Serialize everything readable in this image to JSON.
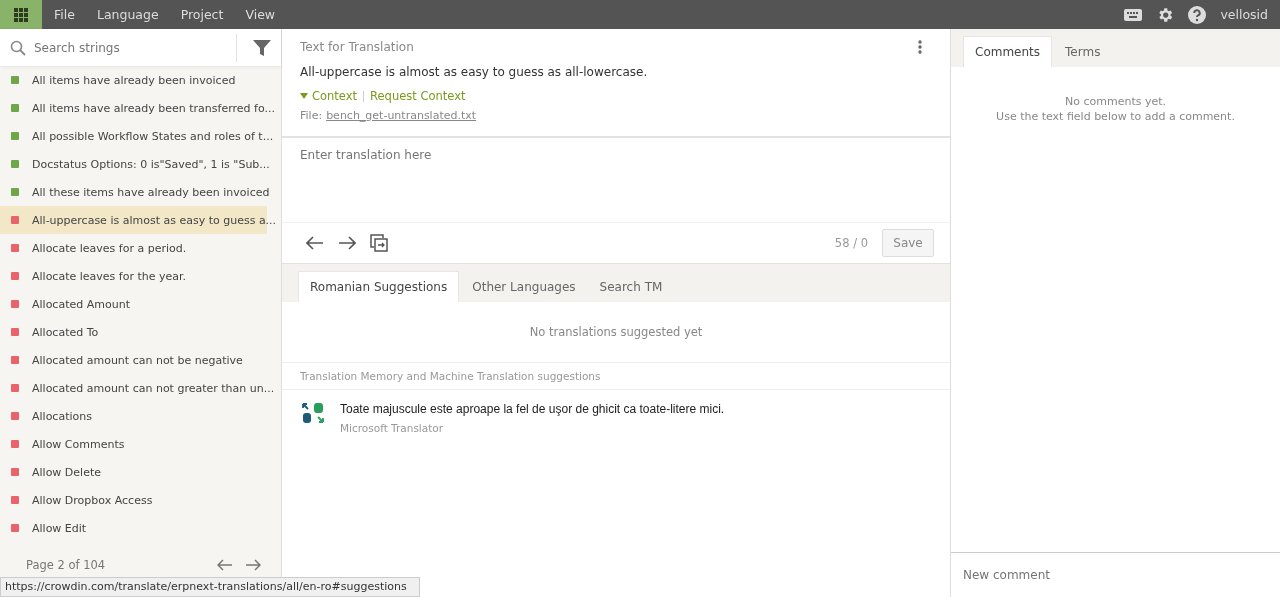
{
  "menu": [
    "File",
    "Language",
    "Project",
    "View"
  ],
  "user": "vellosid",
  "search": {
    "placeholder": "Search strings"
  },
  "strings": [
    {
      "text": "All items have already been invoiced",
      "translated": true,
      "selected": false
    },
    {
      "text": "All items have already been transferred fo...",
      "translated": true,
      "selected": false
    },
    {
      "text": "All possible Workflow States and roles of t...",
      "translated": true,
      "selected": false
    },
    {
      "text": "Docstatus Options: 0 is\"Saved\", 1 is \"Sub...",
      "translated": true,
      "selected": false
    },
    {
      "text": "All these items have already been invoiced",
      "translated": true,
      "selected": false
    },
    {
      "text": "All-uppercase is almost as easy to guess a...",
      "translated": false,
      "selected": true
    },
    {
      "text": "Allocate leaves for a period.",
      "translated": false,
      "selected": false
    },
    {
      "text": "Allocate leaves for the year.",
      "translated": false,
      "selected": false
    },
    {
      "text": "Allocated Amount",
      "translated": false,
      "selected": false
    },
    {
      "text": "Allocated To",
      "translated": false,
      "selected": false
    },
    {
      "text": "Allocated amount can not be negative",
      "translated": false,
      "selected": false
    },
    {
      "text": "Allocated amount can not greater than un...",
      "translated": false,
      "selected": false
    },
    {
      "text": "Allocations",
      "translated": false,
      "selected": false
    },
    {
      "text": "Allow Comments",
      "translated": false,
      "selected": false
    },
    {
      "text": "Allow Delete",
      "translated": false,
      "selected": false
    },
    {
      "text": "Allow Dropbox Access",
      "translated": false,
      "selected": false
    },
    {
      "text": "Allow Edit",
      "translated": false,
      "selected": false
    }
  ],
  "pager": "Page 2 of 104",
  "status_url": "https://crowdin.com/translate/erpnext-translations/all/en-ro#suggestions",
  "source": {
    "heading": "Text for Translation",
    "text": "All-uppercase is almost as easy to guess as all-lowercase.",
    "context": "Context",
    "request_context": "Request Context",
    "file_label": "File:",
    "file": "bench_get-untranslated.txt"
  },
  "translation": {
    "placeholder": "Enter translation here",
    "counter": "58 / 0",
    "save": "Save"
  },
  "suggestion_tabs": [
    {
      "label": "Romanian Suggestions",
      "selected": true
    },
    {
      "label": "Other Languages",
      "selected": false
    },
    {
      "label": "Search TM",
      "selected": false
    }
  ],
  "no_suggestions": "No translations suggested yet",
  "tm_heading": "Translation Memory and Machine Translation suggestions",
  "tm_results": [
    {
      "text": "Toate majuscule este aproape la fel de uşor de ghicit ca toate-litere mici.",
      "source": "Microsoft Translator"
    }
  ],
  "side_tabs": [
    {
      "label": "Comments",
      "selected": true
    },
    {
      "label": "Terms",
      "selected": false
    }
  ],
  "no_comments": [
    "No comments yet.",
    "Use the text field below to add a comment."
  ],
  "comment": {
    "placeholder": "New comment"
  }
}
